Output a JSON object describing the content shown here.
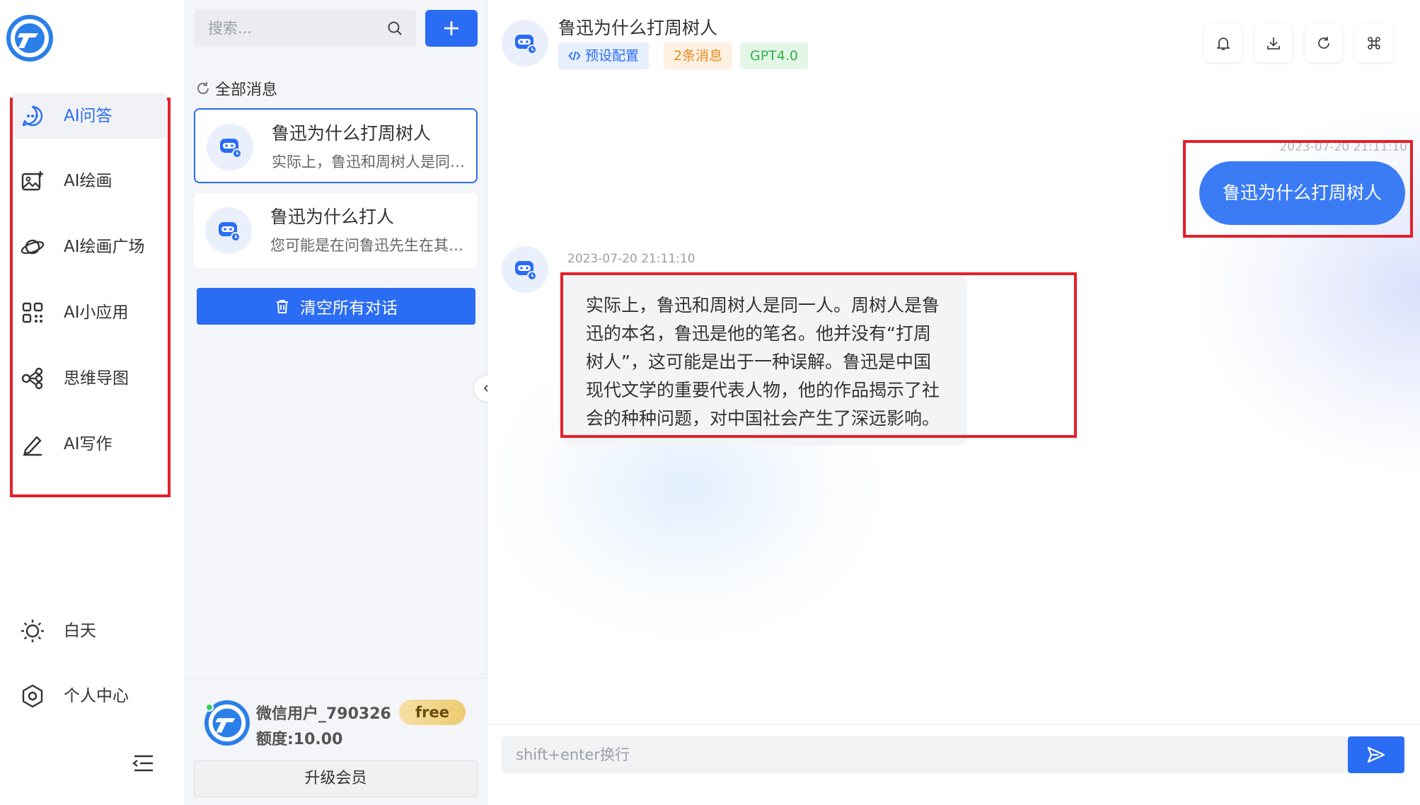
{
  "nav": {
    "items": [
      {
        "label": "AI问答",
        "icon": "chat-bubble-icon",
        "active": true
      },
      {
        "label": "AI绘画",
        "icon": "image-plus-icon",
        "active": false
      },
      {
        "label": "AI绘画广场",
        "icon": "planet-icon",
        "active": false
      },
      {
        "label": "AI小应用",
        "icon": "grid-apps-icon",
        "active": false
      },
      {
        "label": "思维导图",
        "icon": "mindmap-icon",
        "active": false
      },
      {
        "label": "AI写作",
        "icon": "pen-icon",
        "active": false
      }
    ],
    "theme_label": "白天",
    "profile_label": "个人中心"
  },
  "conversations": {
    "search_placeholder": "搜索...",
    "all_label": "全部消息",
    "items": [
      {
        "title": "鲁迅为什么打周树人",
        "preview": "实际上，鲁迅和周树人是同一人。周树人是鲁迅的本名",
        "active": true
      },
      {
        "title": "鲁迅为什么打人",
        "preview": "您可能是在问鲁迅先生在其作品中描写的打人情节",
        "active": false
      }
    ],
    "clear_label": "清空所有对话"
  },
  "user": {
    "name": "微信用户_790326",
    "quota": "额度:10.00",
    "plan_badge": "free",
    "upgrade_label": "升级会员"
  },
  "chat": {
    "title": "鲁迅为什么打周树人",
    "tags": {
      "preset": "预设配置",
      "count": "2条消息",
      "model": "GPT4.0"
    },
    "messages": [
      {
        "role": "user",
        "time": "2023-07-20 21:11:10",
        "text": "鲁迅为什么打周树人"
      },
      {
        "role": "assistant",
        "time": "2023-07-20 21:11:10",
        "text": "实际上，鲁迅和周树人是同一人。周树人是鲁迅的本名，鲁迅是他的笔名。他并没有“打周树人”，这可能是出于一种误解。鲁迅是中国现代文学的重要代表人物，他的作品揭示了社会的种种问题，对中国社会产生了深远影响。"
      }
    ],
    "input_placeholder": "shift+enter换行"
  },
  "colors": {
    "accent": "#2b6cf5",
    "highlight_box": "#e3202a",
    "tag_count": "#e98a1c",
    "tag_model": "#32b04c"
  }
}
